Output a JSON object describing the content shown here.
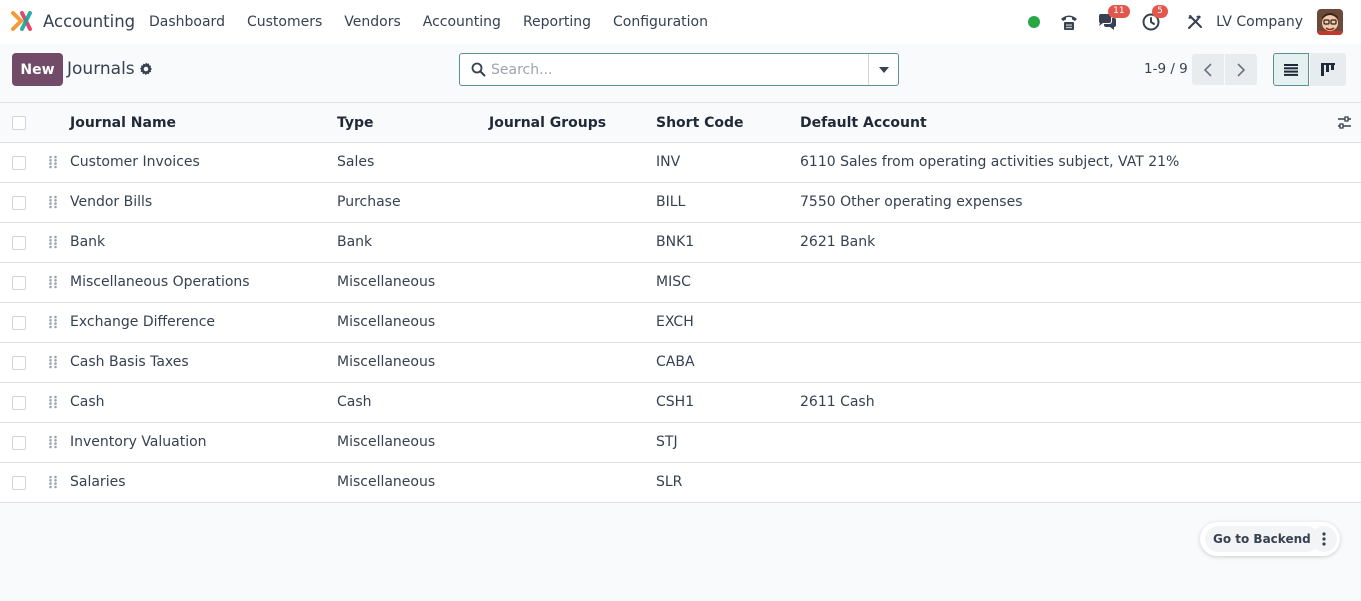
{
  "navbar": {
    "app_name": "Accounting",
    "menu": [
      "Dashboard",
      "Customers",
      "Vendors",
      "Accounting",
      "Reporting",
      "Configuration"
    ],
    "messages_badge": "11",
    "activities_badge": "5",
    "company": "LV Company",
    "status_color": "#28a745"
  },
  "control": {
    "new_label": "New",
    "breadcrumb": "Journals",
    "search_placeholder": "Search...",
    "pager": "1-9 / 9"
  },
  "table": {
    "headers": {
      "name": "Journal Name",
      "type": "Type",
      "groups": "Journal Groups",
      "code": "Short Code",
      "account": "Default Account"
    },
    "rows": [
      {
        "name": "Customer Invoices",
        "type": "Sales",
        "groups": "",
        "code": "INV",
        "account": "6110 Sales from operating activities subject, VAT 21%"
      },
      {
        "name": "Vendor Bills",
        "type": "Purchase",
        "groups": "",
        "code": "BILL",
        "account": "7550 Other operating expenses"
      },
      {
        "name": "Bank",
        "type": "Bank",
        "groups": "",
        "code": "BNK1",
        "account": "2621 Bank"
      },
      {
        "name": "Miscellaneous Operations",
        "type": "Miscellaneous",
        "groups": "",
        "code": "MISC",
        "account": ""
      },
      {
        "name": "Exchange Difference",
        "type": "Miscellaneous",
        "groups": "",
        "code": "EXCH",
        "account": ""
      },
      {
        "name": "Cash Basis Taxes",
        "type": "Miscellaneous",
        "groups": "",
        "code": "CABA",
        "account": ""
      },
      {
        "name": "Cash",
        "type": "Cash",
        "groups": "",
        "code": "CSH1",
        "account": "2611 Cash"
      },
      {
        "name": "Inventory Valuation",
        "type": "Miscellaneous",
        "groups": "",
        "code": "STJ",
        "account": ""
      },
      {
        "name": "Salaries",
        "type": "Miscellaneous",
        "groups": "",
        "code": "SLR",
        "account": ""
      }
    ]
  },
  "floating": {
    "goto_label": "Go to Backend"
  },
  "colors": {
    "primary": "#714b67",
    "accent": "#5d8f94",
    "badge": "#e2574c"
  }
}
